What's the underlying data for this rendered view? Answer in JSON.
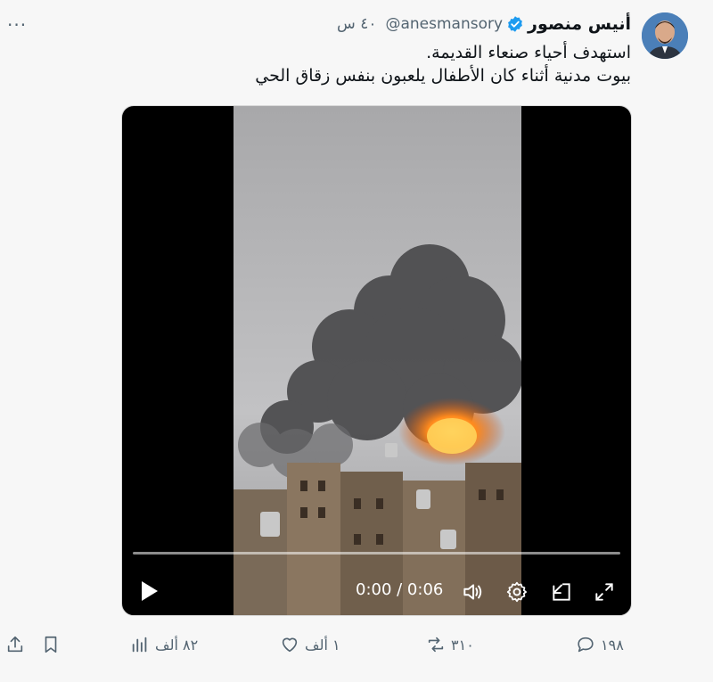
{
  "tweet": {
    "author_name": "أنيس منصور",
    "handle": "@anesmansory",
    "time": "٤٠ س",
    "more_label": "···",
    "line1": "استهدف أحياء صنعاء القديمة.",
    "line2": "بيوت مدنية أثناء كان الأطفال يلعبون بنفس زقاق الحي"
  },
  "video": {
    "timecode": "0:00 / 0:06",
    "controls": [
      "play-icon",
      "volume-icon",
      "settings-icon",
      "picture-in-picture-icon",
      "fullscreen-icon"
    ]
  },
  "actions": {
    "replies": "١٩٨",
    "reposts": "٣١٠",
    "likes": "١ ألف",
    "views": "٨٢ ألف"
  },
  "colors": {
    "accent": "#1d9bf0",
    "muted": "#536471",
    "fire": "#ff8a1c"
  }
}
